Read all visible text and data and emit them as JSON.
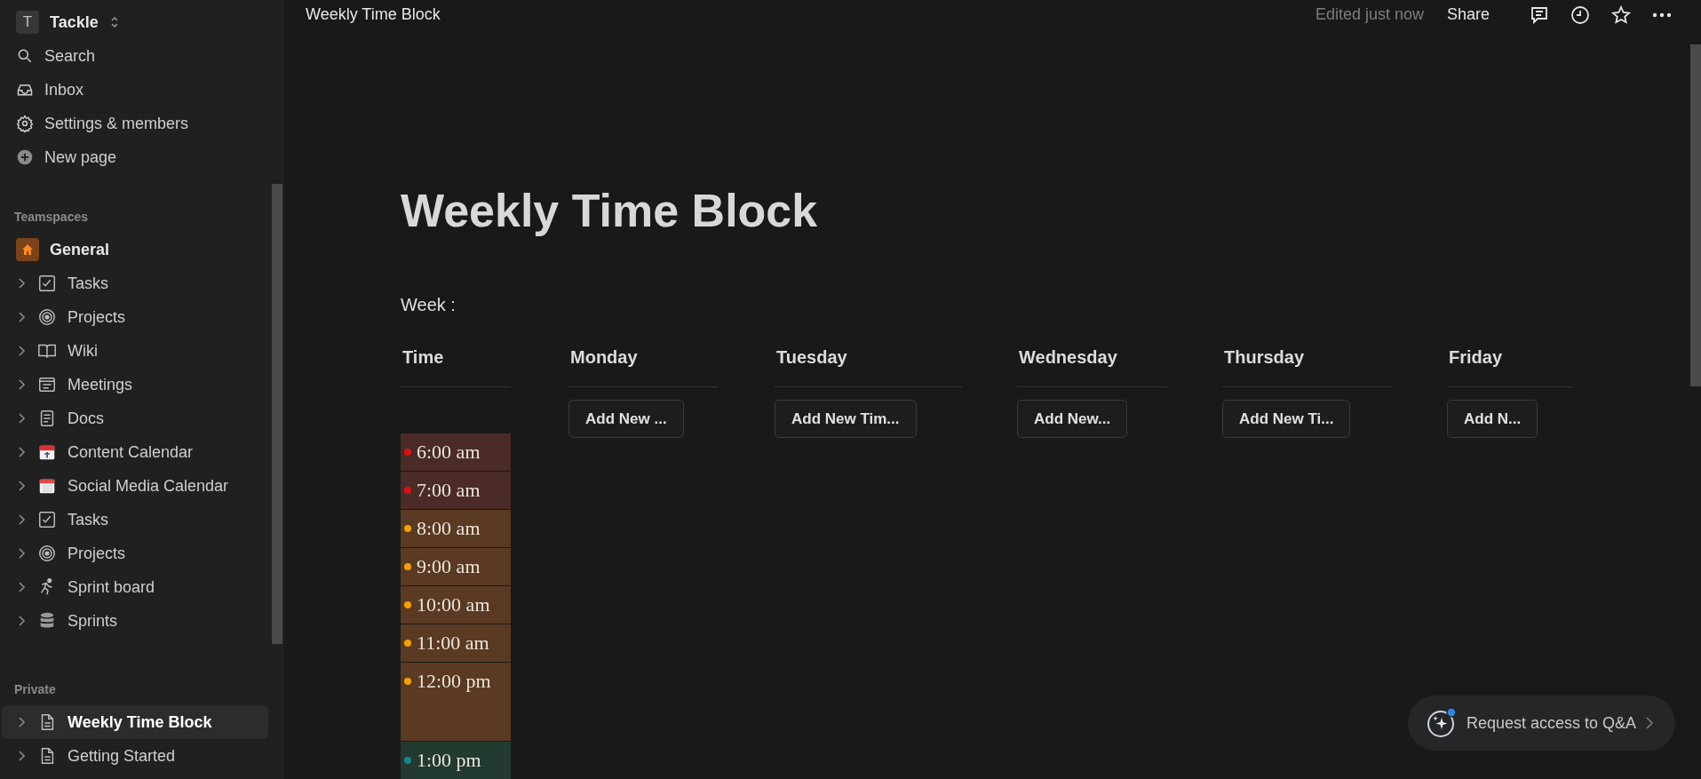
{
  "workspace": {
    "initial": "T",
    "name": "Tackle"
  },
  "nav": [
    {
      "label": "Search",
      "kind": "search"
    },
    {
      "label": "Inbox",
      "kind": "inbox"
    },
    {
      "label": "Settings & members",
      "kind": "settings"
    },
    {
      "label": "New page",
      "kind": "plus"
    }
  ],
  "teamspaces": {
    "heading": "Teamspaces",
    "home": {
      "label": "General"
    },
    "items": [
      {
        "label": "Tasks",
        "kind": "checkbox",
        "selected": false
      },
      {
        "label": "Projects",
        "kind": "target",
        "selected": false
      },
      {
        "label": "Wiki",
        "kind": "book",
        "selected": false
      },
      {
        "label": "Meetings",
        "kind": "list",
        "selected": false
      },
      {
        "label": "Docs",
        "kind": "doc",
        "selected": false
      },
      {
        "label": "Content Calendar",
        "kind": "calendar",
        "selected": false
      },
      {
        "label": "Social Media Calendar",
        "kind": "planner",
        "selected": false
      },
      {
        "label": "Tasks",
        "kind": "checkbox",
        "selected": false
      },
      {
        "label": "Projects",
        "kind": "target",
        "selected": false
      },
      {
        "label": "Sprint board",
        "kind": "runner",
        "selected": false
      },
      {
        "label": "Sprints",
        "kind": "stack",
        "selected": false
      }
    ]
  },
  "private": {
    "heading": "Private",
    "items": [
      {
        "label": "Weekly Time Block",
        "kind": "page",
        "selected": true
      },
      {
        "label": "Getting Started",
        "kind": "page",
        "selected": false
      }
    ]
  },
  "topbar": {
    "breadcrumb": "Weekly Time Block",
    "edited": "Edited just now",
    "share": "Share"
  },
  "page": {
    "title": "Weekly Time Block",
    "week_label": "Week :",
    "time_column": {
      "heading": "Time",
      "slots": [
        {
          "label": "6:00 am",
          "color": "#e01010"
        },
        {
          "label": "7:00 am",
          "color": "#e01010"
        },
        {
          "label": "8:00 am",
          "color": "#f5a000"
        },
        {
          "label": "9:00 am",
          "color": "#f5a000"
        },
        {
          "label": "10:00 am",
          "color": "#f5a000"
        },
        {
          "label": "11:00 am",
          "color": "#f5a000"
        },
        {
          "label": "12:00 pm",
          "color": "#f5a000",
          "tall": true
        },
        {
          "label": "1:00 pm",
          "color": "#17868a"
        }
      ]
    },
    "days": [
      {
        "heading": "Monday",
        "button": "Add New ..."
      },
      {
        "heading": "Tuesday",
        "button": "Add New Tim..."
      },
      {
        "heading": "Wednesday",
        "button": "Add New..."
      },
      {
        "heading": "Thursday",
        "button": "Add New Ti..."
      },
      {
        "heading": "Friday",
        "button": "Add N..."
      }
    ]
  },
  "qa_button": {
    "label": "Request access to Q&A"
  }
}
